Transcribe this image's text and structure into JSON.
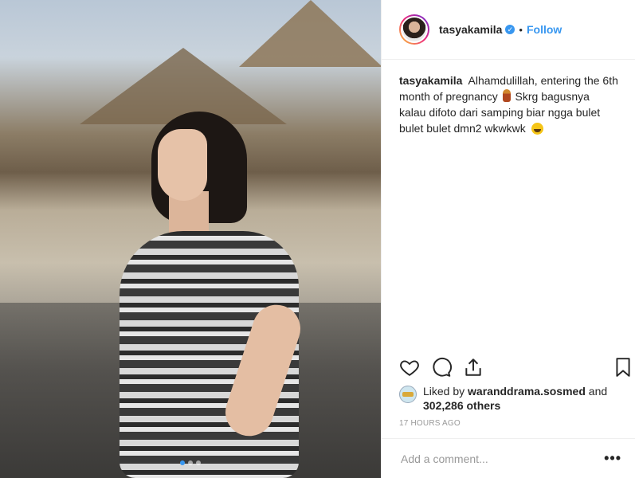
{
  "post": {
    "username": "tasyakamila",
    "follow_label": "Follow",
    "separator": "•",
    "verified_icon": "verified-badge-icon"
  },
  "caption": {
    "username": "tasyakamila",
    "text_before_emoji": "Alhamdulillah, entering the 6th month of pregnancy",
    "text_after_emoji": "Skrg bagusnya kalau difoto dari samping biar ngga bulet bulet bulet dmn2 wkwkwk",
    "emoji_1": "pregnant-woman-emoji",
    "emoji_2": "rolling-on-floor-laughing-emoji"
  },
  "actions": {
    "like_icon": "heart-icon",
    "comment_icon": "comment-icon",
    "share_icon": "share-icon",
    "save_icon": "bookmark-icon"
  },
  "likes": {
    "prefix": "Liked by",
    "user": "waranddrama.sosmed",
    "conjunction": "and",
    "others": "302,286 others"
  },
  "timestamp": "17 HOURS AGO",
  "comment": {
    "placeholder": "Add a comment...",
    "more_label": "•••"
  },
  "carousel": {
    "total": 3,
    "active_index": 0
  },
  "colors": {
    "accent": "#3897f0",
    "text": "#262626",
    "muted": "#999999",
    "border": "#efefef"
  }
}
